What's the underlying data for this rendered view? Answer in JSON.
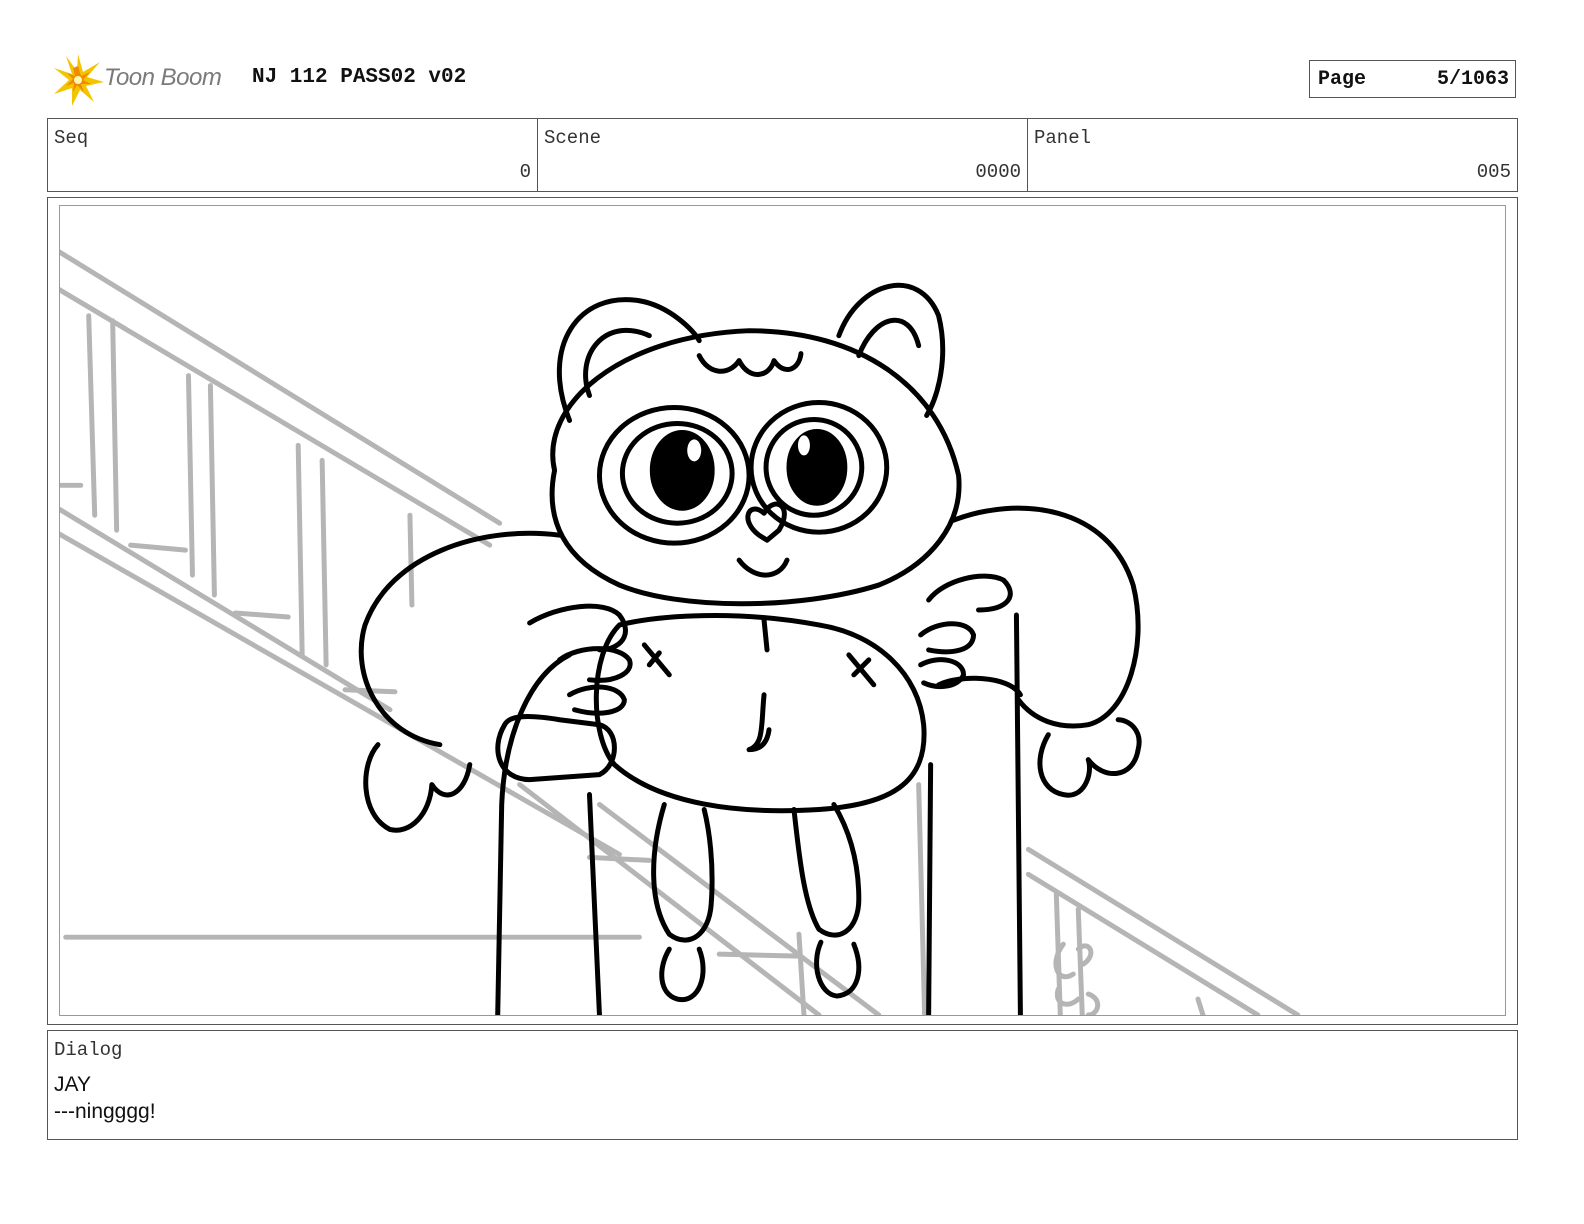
{
  "header": {
    "logo_text": "Toon Boom",
    "logo_icon": "toon-boom-starburst-icon",
    "title": "NJ 112 PASS02 v02",
    "page_label": "Page",
    "page_value": "5/1063"
  },
  "info": {
    "seq_label": "Seq",
    "seq_value": "0",
    "scene_label": "Scene",
    "scene_value": "0000",
    "panel_label": "Panel",
    "panel_value": "005"
  },
  "dialog": {
    "label": "Dialog",
    "speaker": "JAY",
    "line": "---ningggg!"
  },
  "colors": {
    "logo_yellow": "#f5c400",
    "logo_orange": "#f08a00",
    "background_lines": "#b5b5b5",
    "ink": "#000000"
  }
}
